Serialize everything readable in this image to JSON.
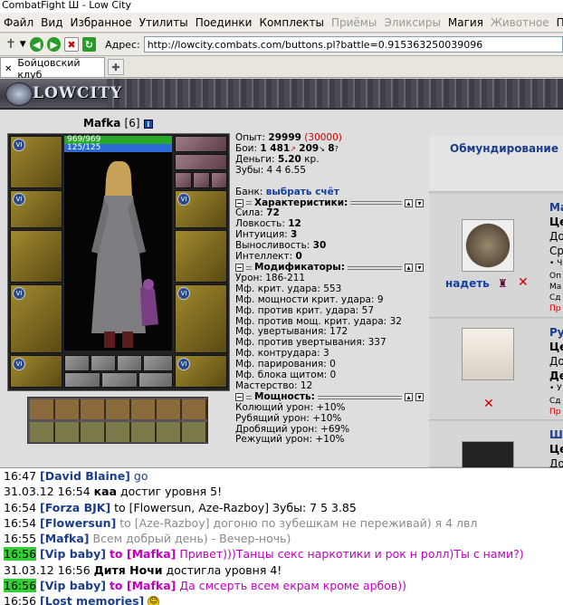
{
  "window": {
    "title": "CombatFight Ш - Low City"
  },
  "menu": {
    "items": [
      {
        "label": "Файл",
        "enabled": true
      },
      {
        "label": "Вид",
        "enabled": true
      },
      {
        "label": "Избранное",
        "enabled": true
      },
      {
        "label": "Утилиты",
        "enabled": true
      },
      {
        "label": "Поединки",
        "enabled": true
      },
      {
        "label": "Комплекты",
        "enabled": true
      },
      {
        "label": "Приёмы",
        "enabled": false
      },
      {
        "label": "Эликсиры",
        "enabled": false
      },
      {
        "label": "Магия",
        "enabled": true
      },
      {
        "label": "Животное",
        "enabled": false
      },
      {
        "label": "Персонаж",
        "enabled": true
      }
    ]
  },
  "nav": {
    "address_label": "Адрес:",
    "url": "http://lowcity.combats.com/buttons.pl?battle=0.915363250039096"
  },
  "tabs": [
    {
      "label": "Бойцовский клуб"
    }
  ],
  "banner": {
    "logo_text": "LOWCITY"
  },
  "character": {
    "name": "Mafka",
    "level": "[6]",
    "hp": "969/969",
    "mana": "125/125"
  },
  "stats": {
    "exp_label": "Опыт:",
    "exp": "29999",
    "exp_next": "(30000)",
    "battles_label": "Бои:",
    "battles_won": "1 481",
    "battles_lost": "209",
    "battles_draw": "8",
    "money_label": "Деньги:",
    "money": "5.20",
    "money_unit": "кр.",
    "teeth_label": "Зубы:",
    "teeth": "4  4  6.55",
    "bank_label": "Банк:",
    "bank_link": "выбрать счёт",
    "char_header": "Характеристики:",
    "attrs": [
      {
        "label": "Сила:",
        "value": "72"
      },
      {
        "label": "Ловкость:",
        "value": "12"
      },
      {
        "label": "Интуиция:",
        "value": "3"
      },
      {
        "label": "Выносливость:",
        "value": "30"
      },
      {
        "label": "Интеллект:",
        "value": "0"
      }
    ],
    "mod_header": "Модификаторы:",
    "mods": [
      {
        "label": "Урон:",
        "value": "186-211"
      },
      {
        "label": "Мф. крит. удара:",
        "value": "553"
      },
      {
        "label": "Мф. мощности крит. удара:",
        "value": "9"
      },
      {
        "label": "Мф. против крит. удара:",
        "value": "57"
      },
      {
        "label": "Мф. против мощ. крит. удара:",
        "value": "32"
      },
      {
        "label": "Мф. увертывания:",
        "value": "172"
      },
      {
        "label": "Мф. против увертывания:",
        "value": "337"
      },
      {
        "label": "Мф. контрудара:",
        "value": "3"
      },
      {
        "label": "Мф. парирования:",
        "value": "0"
      },
      {
        "label": "Мф. блока щитом:",
        "value": "0"
      },
      {
        "label": "Мастерство:",
        "value": "12"
      }
    ],
    "power_header": "Мощность:",
    "power": [
      {
        "label": "Колющий урон:",
        "value": "+10%"
      },
      {
        "label": "Рубящий урон:",
        "value": "+10%"
      },
      {
        "label": "Дробящий урон:",
        "value": "+69%"
      },
      {
        "label": "Режущий урон:",
        "value": "+10%"
      }
    ]
  },
  "equipment": {
    "header": "Обмундирование",
    "items": [
      {
        "name": "Ма",
        "lines": [
          "Це",
          "До",
          "Ср",
          "• Ч",
          "Оп",
          "Ма",
          "Сд",
          "Пр"
        ],
        "wear": "надеть"
      },
      {
        "name": "Ру",
        "lines": [
          "Це",
          "До",
          "Де",
          "• У",
          "Сд",
          "Пр"
        ]
      },
      {
        "name": "Ш",
        "lines": [
          "Це",
          "До"
        ]
      }
    ]
  },
  "chat": [
    {
      "time": "16:47",
      "name": "[David Blaine]",
      "text": "go",
      "kind": "normal"
    },
    {
      "time": "31.03.12 16:54",
      "name": "каа",
      "text": "достиг уровня 5!",
      "kind": "system"
    },
    {
      "time": "16:54",
      "name": "[Forza BJK]",
      "text": "to [Flowersun, Aze-Razboy] Зубы: 7 5 3.85",
      "kind": "normal"
    },
    {
      "time": "16:54",
      "name": "[Flowersun]",
      "text": "to [Aze-Razboy] догоню по зубешкам не переживай) я 4 лвл",
      "kind": "grayhead"
    },
    {
      "time": "16:55",
      "name": "[Mafka]",
      "text": "Всем добрый день) - Вечер-ночь)",
      "kind": "gray"
    },
    {
      "time": "16:56",
      "name": "[Vip baby]",
      "to": "to [Mafka]",
      "text": "Привет)))Танцы секс наркотики и рок н ролл)Ты с нами?)",
      "kind": "private"
    },
    {
      "time": "31.03.12 16:56",
      "name": "Дитя Ночи",
      "text": "достигла уровня 4!",
      "kind": "system"
    },
    {
      "time": "16:56",
      "name": "[Vip baby]",
      "to": "to [Mafka]",
      "text": "Да смсерть всем екрам кроме арбов))",
      "kind": "private"
    },
    {
      "time": "16:56",
      "name": "[Lost memories]",
      "text": "",
      "kind": "smiley"
    }
  ],
  "colors": {
    "link": "#1a3d8c",
    "private": "#c000c0",
    "highlight": "#30d030",
    "exp_next": "#cc0000"
  }
}
